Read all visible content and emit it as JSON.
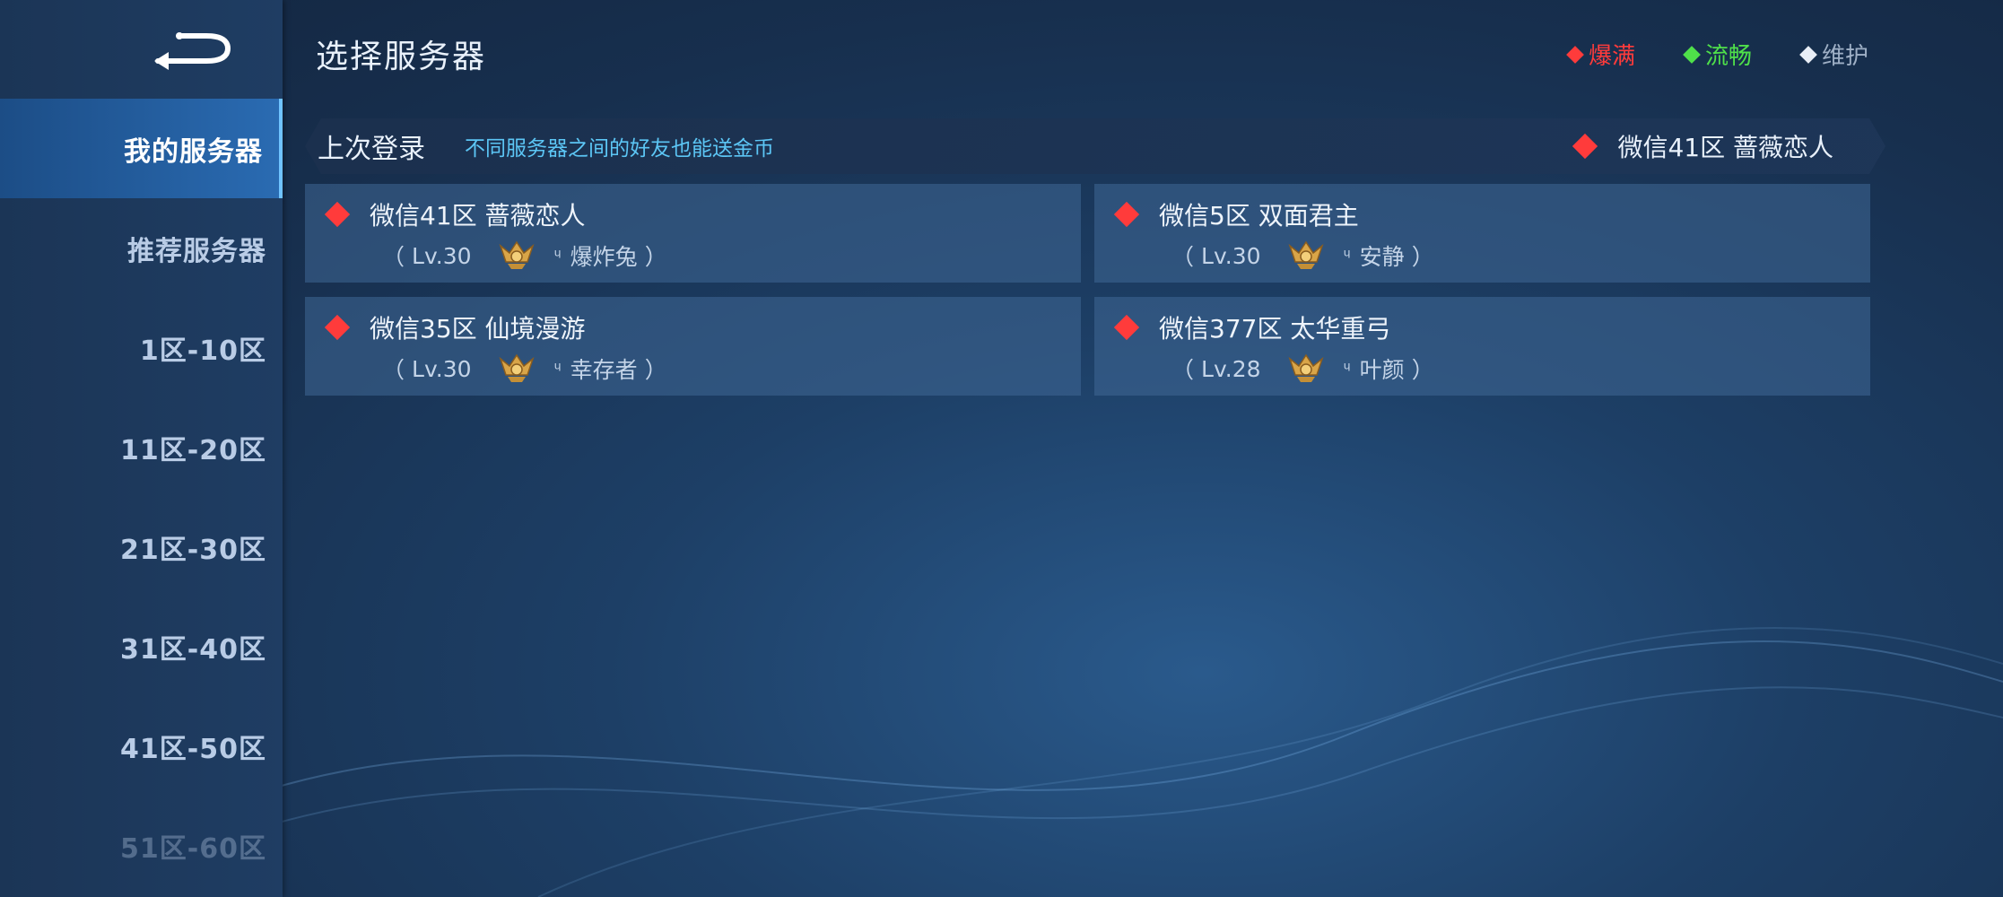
{
  "header": {
    "title": "选择服务器"
  },
  "legend": [
    {
      "label": "爆满",
      "color": "#ff3b3b"
    },
    {
      "label": "流畅",
      "color": "#4fe04a"
    },
    {
      "label": "维护",
      "color": "#b8c4d4"
    }
  ],
  "sidebar": {
    "items": [
      {
        "label": "我的服务器"
      },
      {
        "label": "推荐服务器"
      },
      {
        "label": "1区-10区"
      },
      {
        "label": "11区-20区"
      },
      {
        "label": "21区-30区"
      },
      {
        "label": "31区-40区"
      },
      {
        "label": "41区-50区"
      },
      {
        "label": "51区-60区"
      }
    ]
  },
  "last_login": {
    "label": "上次登录",
    "tip": "不同服务器之间的好友也能送金币",
    "server": "微信41区 蔷薇恋人",
    "status_color": "#ff3b3b"
  },
  "servers": [
    {
      "name": "微信41区 蔷薇恋人",
      "open": "（",
      "level": "Lv.30",
      "mark": "ᶣ",
      "player": "爆炸兔",
      "close": "）",
      "status_color": "#ff3b3b"
    },
    {
      "name": "微信5区 双面君主",
      "open": "（",
      "level": "Lv.30",
      "mark": "ᶣ",
      "player": "安静",
      "close": "）",
      "status_color": "#ff3b3b"
    },
    {
      "name": "微信35区 仙境漫游",
      "open": "（",
      "level": "Lv.30",
      "mark": "ᶣ",
      "player": "幸存者",
      "close": "）",
      "status_color": "#ff3b3b"
    },
    {
      "name": "微信377区 太华重弓",
      "open": "（",
      "level": "Lv.28",
      "mark": "ᶣ",
      "player": "叶颜",
      "close": "）",
      "status_color": "#ff3b3b"
    }
  ]
}
